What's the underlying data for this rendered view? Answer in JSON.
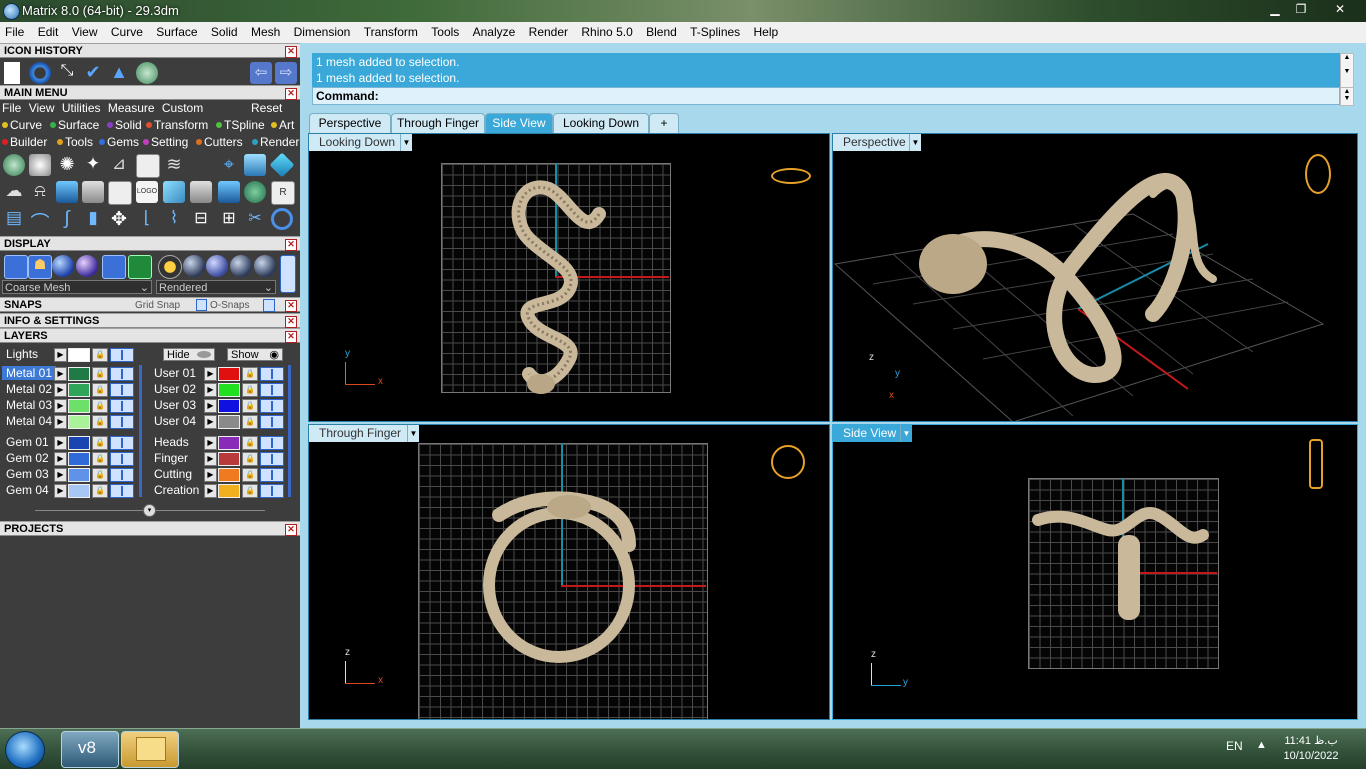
{
  "window": {
    "title": "Matrix 8.0 (64-bit) - 29.3dm",
    "minimize": "▁",
    "restore": "❐",
    "close": "✕"
  },
  "menubar": [
    "File",
    "Edit",
    "View",
    "Curve",
    "Surface",
    "Solid",
    "Mesh",
    "Dimension",
    "Transform",
    "Tools",
    "Analyze",
    "Render",
    "Rhino 5.0",
    "Blend",
    "T-Splines",
    "Help"
  ],
  "left_panel": {
    "icon_history_title": "ICON HISTORY",
    "main_menu_title": "MAIN MENU",
    "main_menu_items": [
      "File",
      "View",
      "Utilities",
      "Measure",
      "Custom"
    ],
    "reset_label": "Reset",
    "row1": [
      {
        "label": "Curve",
        "color": "#e0c020"
      },
      {
        "label": "Surface",
        "color": "#36b24a"
      },
      {
        "label": "Solid",
        "color": "#8a3ec4"
      },
      {
        "label": "Transform",
        "color": "#e05030"
      },
      {
        "label": "TSpline",
        "color": "#50c040"
      },
      {
        "label": "Art",
        "color": "#e0c020"
      }
    ],
    "row2": [
      {
        "label": "Builder",
        "color": "#e02020"
      },
      {
        "label": "Tools",
        "color": "#e0a020"
      },
      {
        "label": "Gems",
        "color": "#3070e0"
      },
      {
        "label": "Setting",
        "color": "#c040c0"
      },
      {
        "label": "Cutters",
        "color": "#e07020"
      },
      {
        "label": "Render",
        "color": "#30a0c0"
      }
    ],
    "display_title": "DISPLAY",
    "mesh_select": "Coarse Mesh",
    "render_select": "Rendered",
    "snaps_title": "SNAPS",
    "grid_snap": "Grid Snap",
    "osnaps": "O-Snaps",
    "info_title": "INFO & SETTINGS",
    "layers_title": "LAYERS",
    "lights_label": "Lights",
    "hide_label": "Hide",
    "show_label": "Show",
    "layers_left": [
      {
        "name": "Metal 01",
        "color": "#1f7a45"
      },
      {
        "name": "Metal 02",
        "color": "#2fa55a"
      },
      {
        "name": "Metal 03",
        "color": "#6de06a"
      },
      {
        "name": "Metal 04",
        "color": "#a9f29a"
      },
      {
        "name": "Gem 01",
        "color": "#1a45b0"
      },
      {
        "name": "Gem 02",
        "color": "#2f6ad8"
      },
      {
        "name": "Gem 03",
        "color": "#5f93ea"
      },
      {
        "name": "Gem 04",
        "color": "#a8c6f4"
      }
    ],
    "layers_right": [
      {
        "name": "User 01",
        "color": "#e01010"
      },
      {
        "name": "User 02",
        "color": "#20e020"
      },
      {
        "name": "User 03",
        "color": "#1010e0"
      },
      {
        "name": "User 04",
        "color": "#8a8a8a"
      },
      {
        "name": "Heads",
        "color": "#8a2ab8"
      },
      {
        "name": "Finger",
        "color": "#b83a3a"
      },
      {
        "name": "Cutting",
        "color": "#f07a20"
      },
      {
        "name": "Creation",
        "color": "#f0b020"
      }
    ],
    "projects_title": "PROJECTS"
  },
  "command": {
    "history": [
      "1 mesh added to selection.",
      "1 mesh added to selection."
    ],
    "prompt": "Command:"
  },
  "tabs": [
    {
      "label": "Perspective",
      "active": false
    },
    {
      "label": "Through Finger",
      "active": false
    },
    {
      "label": "Side View",
      "active": true
    },
    {
      "label": "Looking Down",
      "active": false
    }
  ],
  "add_tab": "+",
  "viewports": {
    "top_left": {
      "label": "Looking Down",
      "axis1": "y",
      "axis2": "x"
    },
    "top_right": {
      "label": "Perspective",
      "axis1": "z",
      "axis2": "y",
      "axis3": "x"
    },
    "bottom_left": {
      "label": "Through Finger",
      "axis1": "z",
      "axis2": "x"
    },
    "bottom_right": {
      "label": "Side View",
      "axis1": "z",
      "axis2": "y"
    }
  },
  "taskbar": {
    "lang": "EN",
    "tray_arrow": "▲",
    "time": "11:41 ب.ظ",
    "date": "10/10/2022"
  }
}
